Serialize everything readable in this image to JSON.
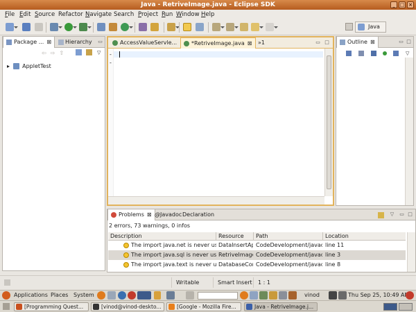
{
  "window": {
    "title": "Java - RetriveImage.java - Eclipse SDK"
  },
  "menu": [
    {
      "label": "File",
      "ul": "F",
      "rest": "ile"
    },
    {
      "label": "Edit",
      "ul": "E",
      "rest": "dit"
    },
    {
      "label": "Source",
      "ul": "S",
      "rest": "ource"
    },
    {
      "label": "Refactor",
      "ul": "",
      "rest": "Refactor"
    },
    {
      "label": "Navigate",
      "ul": "N",
      "rest": "avigate"
    },
    {
      "label": "Search",
      "ul": "",
      "rest": "Search"
    },
    {
      "label": "Project",
      "ul": "P",
      "rest": "roject"
    },
    {
      "label": "Run",
      "ul": "R",
      "rest": "un"
    },
    {
      "label": "Window",
      "ul": "W",
      "rest": "indow"
    },
    {
      "label": "Help",
      "ul": "H",
      "rest": "elp"
    }
  ],
  "perspective": {
    "label": "Java"
  },
  "explorer": {
    "tabs": [
      "Package ...",
      "Hierarchy"
    ],
    "tree": [
      "AppletTest"
    ]
  },
  "editor": {
    "tabs": [
      "AccessValueServle...",
      "*RetriveImage.java"
    ],
    "overflow": "»1"
  },
  "outline": {
    "tab": "Outline"
  },
  "problems": {
    "tabs": [
      "Problems",
      "Javadoc",
      "Declaration"
    ],
    "summary": "2 errors, 73 warnings, 0 infos",
    "columns": [
      "Description",
      "Resource",
      "Path",
      "Location"
    ],
    "rows": [
      {
        "description": "The import java.net is never used",
        "resource": "DataInsertApp",
        "path": "CodeDevelopment/javacode",
        "location": "line 11"
      },
      {
        "description": "The import java.sql is never used",
        "resource": "RetriveImage.",
        "path": "CodeDevelopment/javacode",
        "location": "line 3"
      },
      {
        "description": "The import java.text is never used",
        "resource": "DatabaseCon",
        "path": "CodeDevelopment/javacode",
        "location": "line 8"
      }
    ],
    "selected_row": 1
  },
  "status": {
    "mode": "Writable",
    "insert": "Smart Insert",
    "position": "1 : 1"
  },
  "gnome": {
    "applications": "Applications",
    "places": "Places",
    "system": "System",
    "user": "vinod",
    "clock": "Thu Sep 25, 10:49 AM"
  },
  "taskbar": [
    {
      "label": "[Programming Quest...",
      "color": "#c94f1d"
    },
    {
      "label": "[vinod@vinod-deskto...",
      "color": "#333333"
    },
    {
      "label": "[Google - Mozilla Fire...",
      "color": "#e87f1b"
    },
    {
      "label": "Java - RetriveImage.j...",
      "color": "#3a5fa8"
    }
  ],
  "colors": {
    "title_bar": "#c26a2c",
    "editor_border": "#e2b35c",
    "selection": "#dcd8d2"
  }
}
